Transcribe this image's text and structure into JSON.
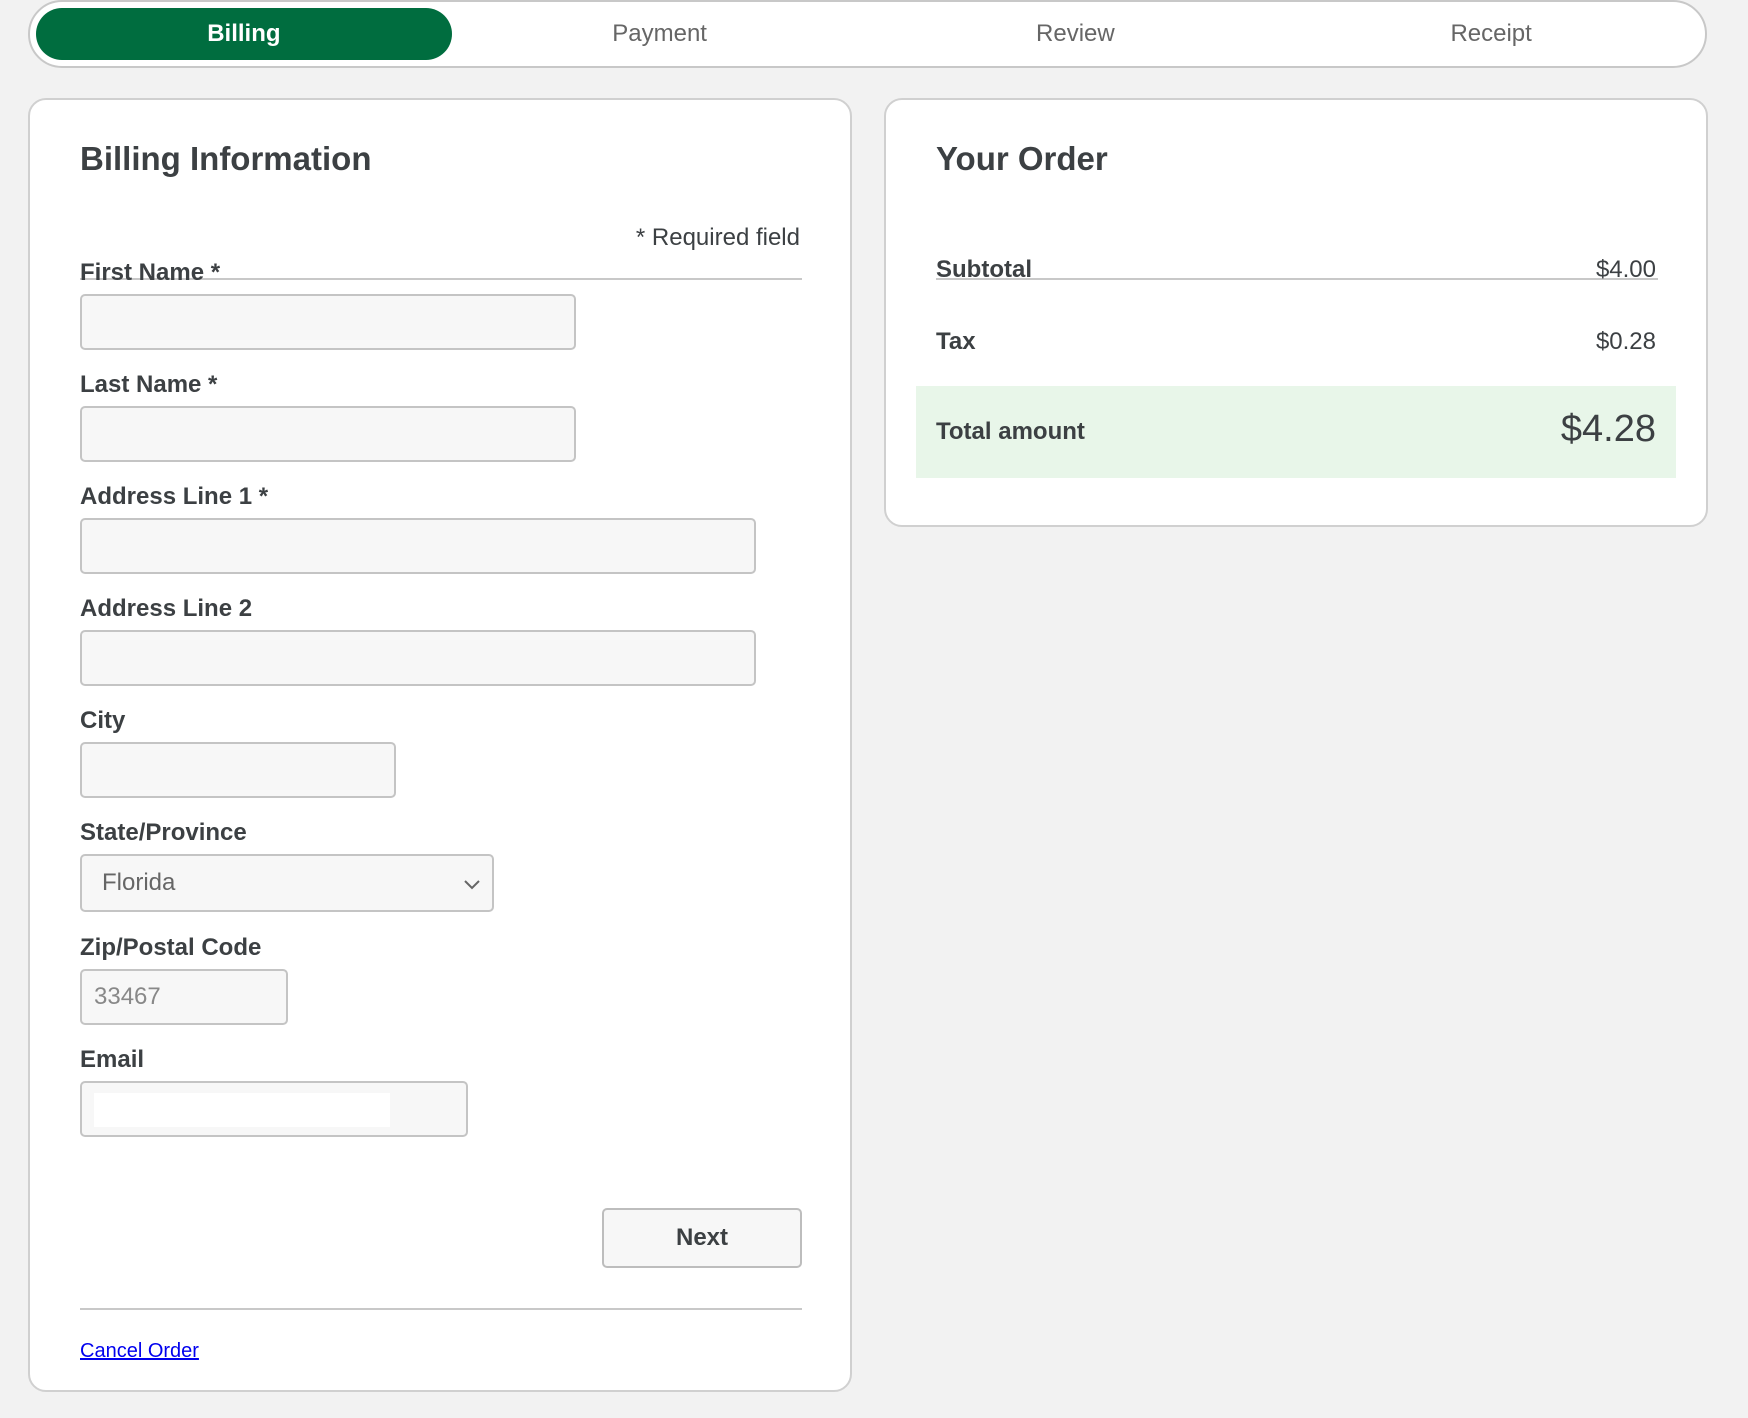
{
  "steps": [
    {
      "label": "Billing",
      "active": true
    },
    {
      "label": "Payment",
      "active": false
    },
    {
      "label": "Review",
      "active": false
    },
    {
      "label": "Receipt",
      "active": false
    }
  ],
  "billing": {
    "title": "Billing Information",
    "required_note": "* Required field",
    "fields": {
      "first_name": {
        "label": "First Name *",
        "value": ""
      },
      "last_name": {
        "label": "Last Name *",
        "value": ""
      },
      "address1": {
        "label": "Address Line 1 *",
        "value": ""
      },
      "address2": {
        "label": "Address Line 2",
        "value": ""
      },
      "city": {
        "label": "City",
        "value": ""
      },
      "state": {
        "label": "State/Province",
        "selected": "Florida"
      },
      "zip": {
        "label": "Zip/Postal Code",
        "placeholder": "33467"
      },
      "email": {
        "label": "Email",
        "value": ""
      }
    },
    "next_label": "Next",
    "cancel_label": "Cancel Order"
  },
  "order": {
    "title": "Your Order",
    "subtotal_label": "Subtotal",
    "subtotal_value": "$4.00",
    "tax_label": "Tax",
    "tax_value": "$0.28",
    "total_label": "Total amount",
    "total_value": "$4.28"
  },
  "colors": {
    "accent": "#006d3f",
    "total_bg": "#e8f6e9",
    "page_bg": "#f2f2f2"
  }
}
